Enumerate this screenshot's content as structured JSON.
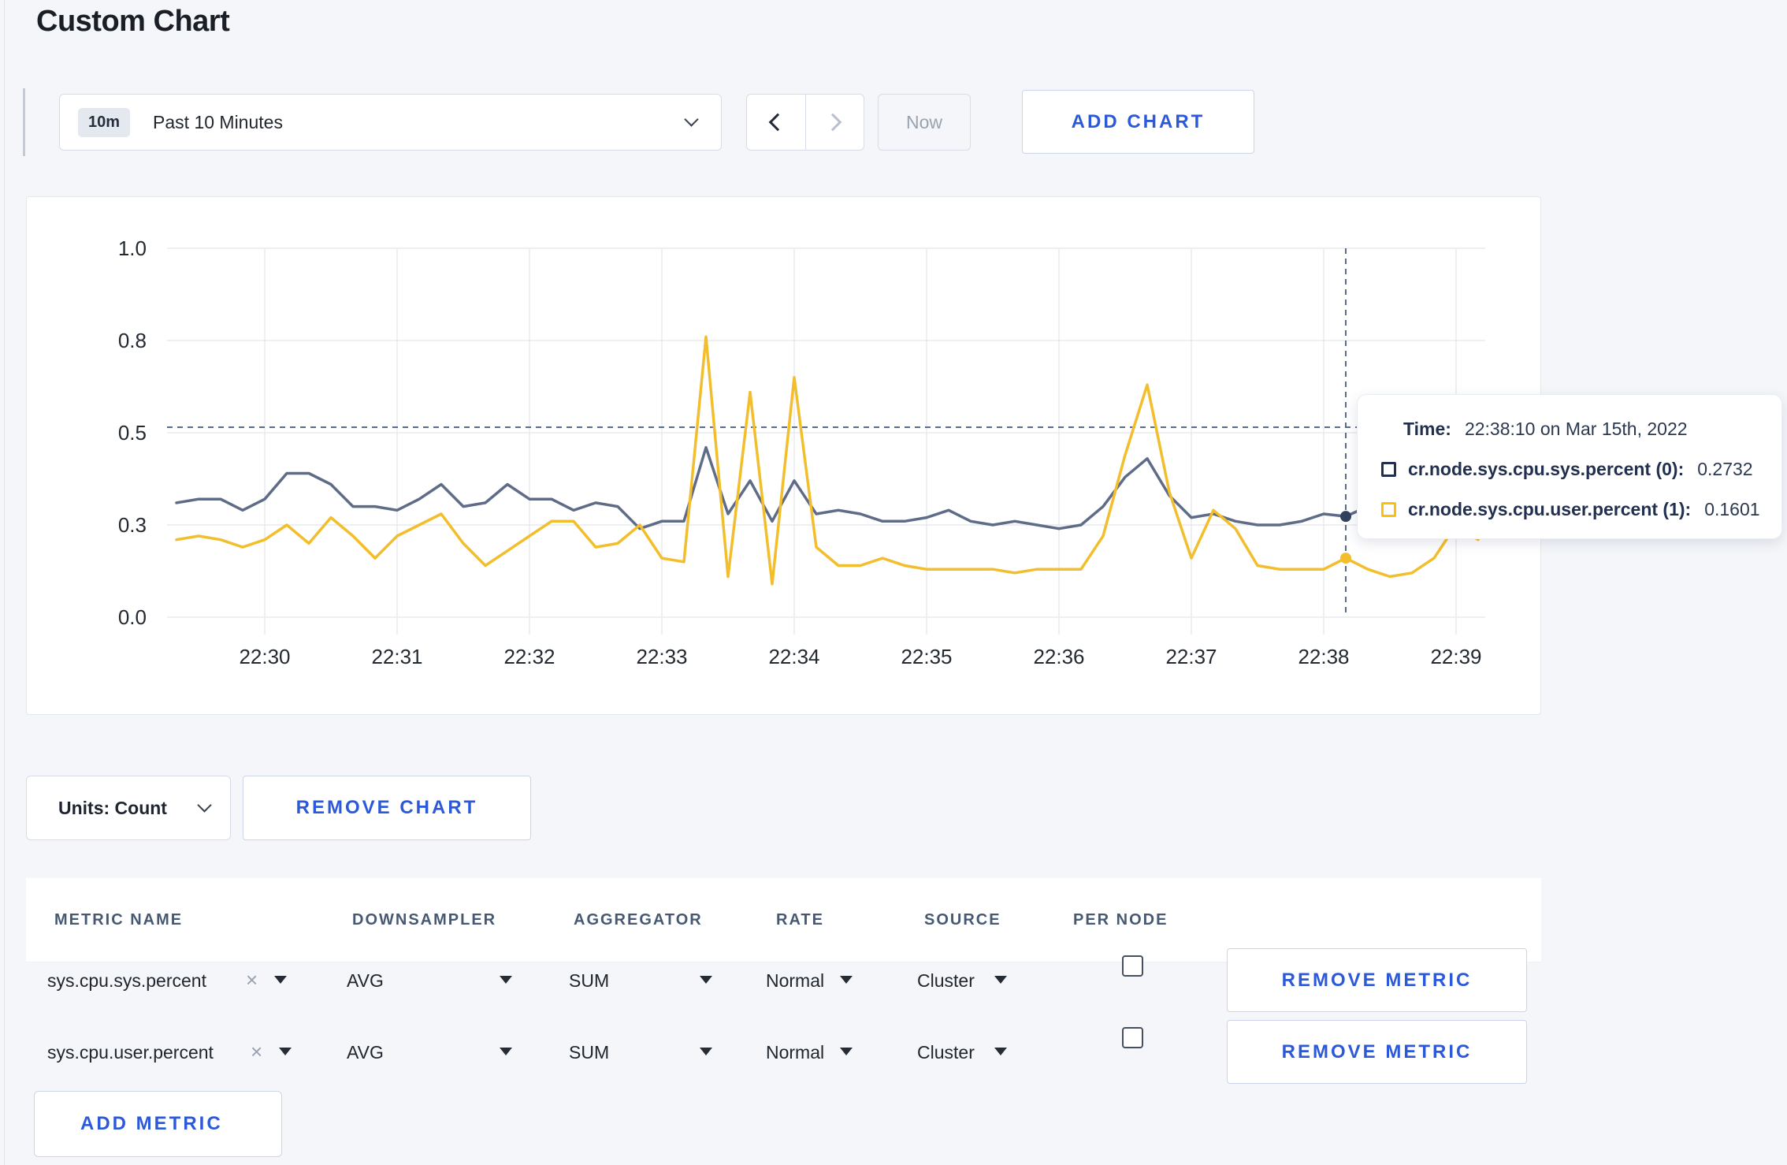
{
  "page": {
    "title": "Custom Chart"
  },
  "icons": {
    "clear_glyph": "×"
  },
  "toolbar": {
    "time_badge": "10m",
    "time_label": "Past 10 Minutes",
    "now_label": "Now",
    "add_chart_label": "ADD CHART"
  },
  "chart_controls": {
    "units_label": "Units: Count",
    "remove_chart_label": "REMOVE CHART"
  },
  "tooltip": {
    "time_label": "Time:",
    "time_value": "22:38:10 on Mar 15th, 2022",
    "rows": [
      {
        "label": "cr.node.sys.cpu.sys.percent (0):",
        "value": "0.2732",
        "color": "#22304f"
      },
      {
        "label": "cr.node.sys.cpu.user.percent (1):",
        "value": "0.1601",
        "color": "#fdc008"
      }
    ]
  },
  "metrics_table": {
    "headers": [
      "METRIC NAME",
      "DOWNSAMPLER",
      "AGGREGATOR",
      "RATE",
      "SOURCE",
      "PER NODE"
    ],
    "rows": [
      {
        "metric_name": "sys.cpu.sys.percent",
        "downsampler": "AVG",
        "aggregator": "SUM",
        "rate": "Normal",
        "source": "Cluster",
        "per_node_checked": false,
        "remove_label": "REMOVE METRIC"
      },
      {
        "metric_name": "sys.cpu.user.percent",
        "downsampler": "AVG",
        "aggregator": "SUM",
        "rate": "Normal",
        "source": "Cluster",
        "per_node_checked": false,
        "remove_label": "REMOVE METRIC"
      }
    ],
    "add_metric_label": "ADD METRIC"
  },
  "chart_data": {
    "type": "line",
    "title": "",
    "xlabel": "",
    "ylabel": "",
    "grid": true,
    "x_axis": {
      "tick_labels": [
        "22:30",
        "22:31",
        "22:32",
        "22:33",
        "22:34",
        "22:35",
        "22:36",
        "22:37",
        "22:38",
        "22:39"
      ],
      "tick_minutes": [
        0,
        1,
        2,
        3,
        4,
        5,
        6,
        7,
        8,
        9
      ]
    },
    "y_axis": {
      "tick_labels": [
        "0.0",
        "0.3",
        "0.5",
        "0.8",
        "1.0"
      ],
      "tick_values": [
        0,
        0.25,
        0.5,
        0.75,
        1.0
      ],
      "range": [
        0,
        1
      ]
    },
    "x_start_minutes": -0.6667,
    "x_step_minutes": 0.16667,
    "hline_value": 0.515,
    "crosshair": {
      "x_minutes": 8.1667,
      "time": "22:38:10"
    },
    "series": [
      {
        "name": "cr.node.sys.cpu.sys.percent",
        "color": "#5f6c87",
        "dot_color": "#33415f",
        "crosshair_value": 0.2732,
        "values": [
          0.31,
          0.32,
          0.32,
          0.29,
          0.32,
          0.39,
          0.39,
          0.36,
          0.3,
          0.3,
          0.29,
          0.32,
          0.36,
          0.3,
          0.31,
          0.36,
          0.32,
          0.32,
          0.29,
          0.31,
          0.3,
          0.24,
          0.26,
          0.26,
          0.46,
          0.28,
          0.37,
          0.26,
          0.37,
          0.28,
          0.29,
          0.28,
          0.26,
          0.26,
          0.27,
          0.29,
          0.26,
          0.25,
          0.26,
          0.25,
          0.24,
          0.25,
          0.3,
          0.38,
          0.43,
          0.33,
          0.27,
          0.28,
          0.26,
          0.25,
          0.25,
          0.26,
          0.28,
          0.2732,
          0.3,
          0.3,
          0.29,
          0.29,
          0.3,
          0.3
        ]
      },
      {
        "name": "cr.node.sys.cpu.user.percent",
        "color": "#f2be2c",
        "dot_color": "#f2be2c",
        "crosshair_value": 0.1601,
        "values": [
          0.21,
          0.22,
          0.21,
          0.19,
          0.21,
          0.25,
          0.2,
          0.27,
          0.22,
          0.16,
          0.22,
          0.25,
          0.28,
          0.2,
          0.14,
          0.18,
          0.22,
          0.26,
          0.26,
          0.19,
          0.2,
          0.25,
          0.16,
          0.15,
          0.76,
          0.11,
          0.61,
          0.09,
          0.65,
          0.19,
          0.14,
          0.14,
          0.16,
          0.14,
          0.13,
          0.13,
          0.13,
          0.13,
          0.12,
          0.13,
          0.13,
          0.13,
          0.22,
          0.44,
          0.63,
          0.34,
          0.16,
          0.29,
          0.24,
          0.14,
          0.13,
          0.13,
          0.13,
          0.1601,
          0.13,
          0.11,
          0.12,
          0.16,
          0.25,
          0.21
        ]
      }
    ]
  }
}
